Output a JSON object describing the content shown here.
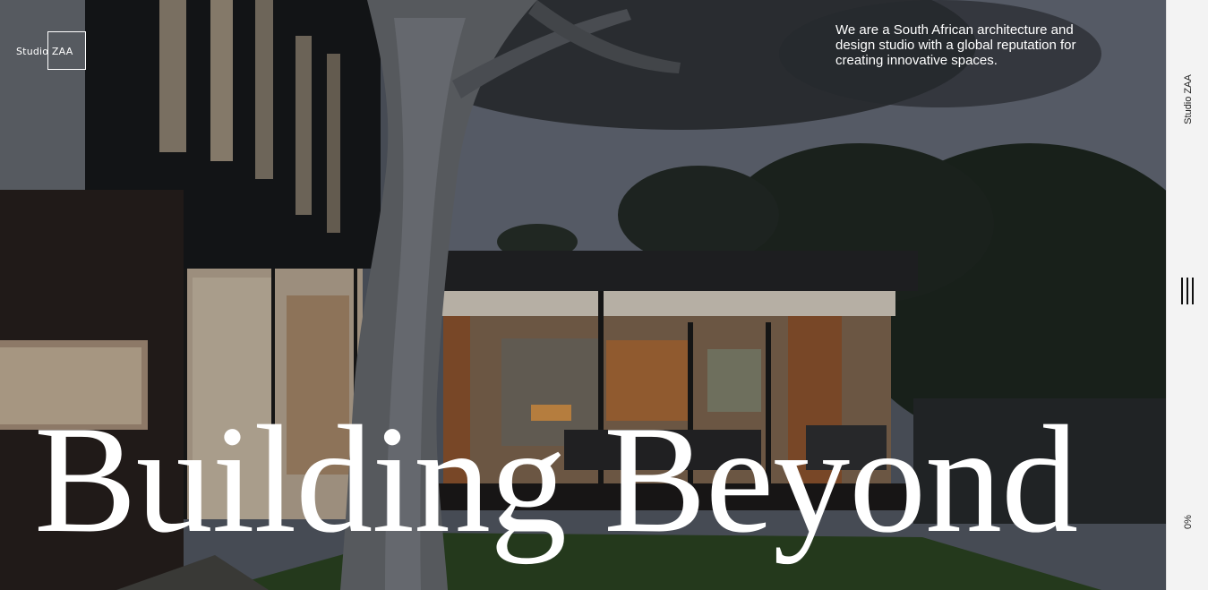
{
  "brand": {
    "logo_text": "Studio ZAA",
    "side_label": "Studio ZAA"
  },
  "hero": {
    "tagline": "We are a South African architecture and design studio with a global reputation for creating innovative spaces.",
    "headline": "Building Beyond",
    "image_subject": "modern house exterior at dusk with large tree"
  },
  "sidebar": {
    "menu_icon": "menu-lines-icon",
    "progress_label": "0%"
  },
  "colors": {
    "rail_background": "#f3f3f3",
    "headline_text": "#ffffff",
    "rail_text": "#222222"
  }
}
